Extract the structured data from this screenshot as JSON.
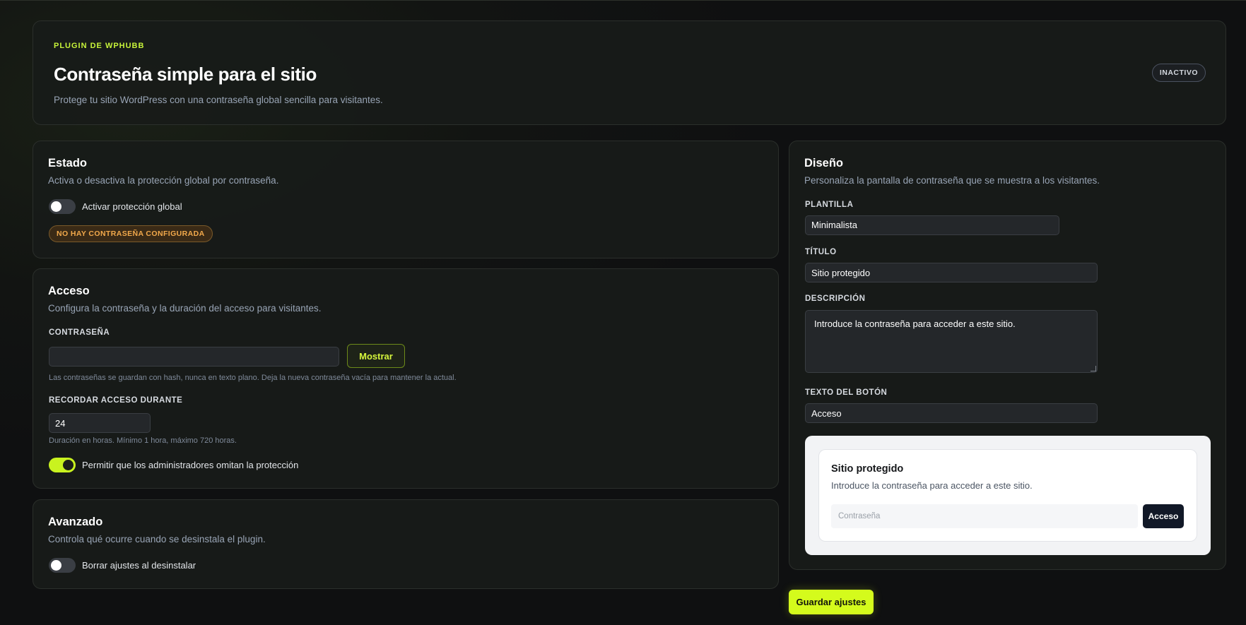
{
  "header": {
    "eyebrow": "PLUGIN DE WPHUBB",
    "title": "Contraseña simple para el sitio",
    "subtitle": "Protege tu sitio WordPress con una contraseña global sencilla para visitantes.",
    "status_badge": "INACTIVO"
  },
  "estado": {
    "title": "Estado",
    "description": "Activa o desactiva la protección global por contraseña.",
    "toggle_label": "Activar protección global",
    "toggle_on": false,
    "warning_badge": "NO HAY CONTRASEÑA CONFIGURADA"
  },
  "acceso": {
    "title": "Acceso",
    "description": "Configura la contraseña y la duración del acceso para visitantes.",
    "password_label": "CONTRASEÑA",
    "password_value": "",
    "show_button": "Mostrar",
    "password_hint": "Las contraseñas se guardan con hash, nunca en texto plano. Deja la nueva contraseña vacía para mantener la actual.",
    "remember_label": "RECORDAR ACCESO DURANTE",
    "remember_value": "24",
    "remember_hint": "Duración en horas. Mínimo 1 hora, máximo 720 horas.",
    "admin_toggle_label": "Permitir que los administradores omitan la protección",
    "admin_toggle_on": true
  },
  "avanzado": {
    "title": "Avanzado",
    "description": "Controla qué ocurre cuando se desinstala el plugin.",
    "toggle_label": "Borrar ajustes al desinstalar",
    "toggle_on": false
  },
  "diseno": {
    "title": "Diseño",
    "description": "Personaliza la pantalla de contraseña que se muestra a los visitantes.",
    "template_label": "PLANTILLA",
    "template_value": "Minimalista",
    "title_label": "TÍTULO",
    "title_value": "Sitio protegido",
    "description_label": "DESCRIPCIÓN",
    "description_value": "Introduce la contraseña para acceder a este sitio.",
    "button_text_label": "TEXTO DEL BOTÓN",
    "button_text_value": "Acceso",
    "preview": {
      "title": "Sitio protegido",
      "description": "Introduce la contraseña para acceder a este sitio.",
      "input_placeholder": "Contraseña",
      "button": "Acceso"
    }
  },
  "save_button": "Guardar ajustes",
  "colors": {
    "accent": "#d4fb1c",
    "warning": "#f2a94b",
    "background": "#121412"
  }
}
